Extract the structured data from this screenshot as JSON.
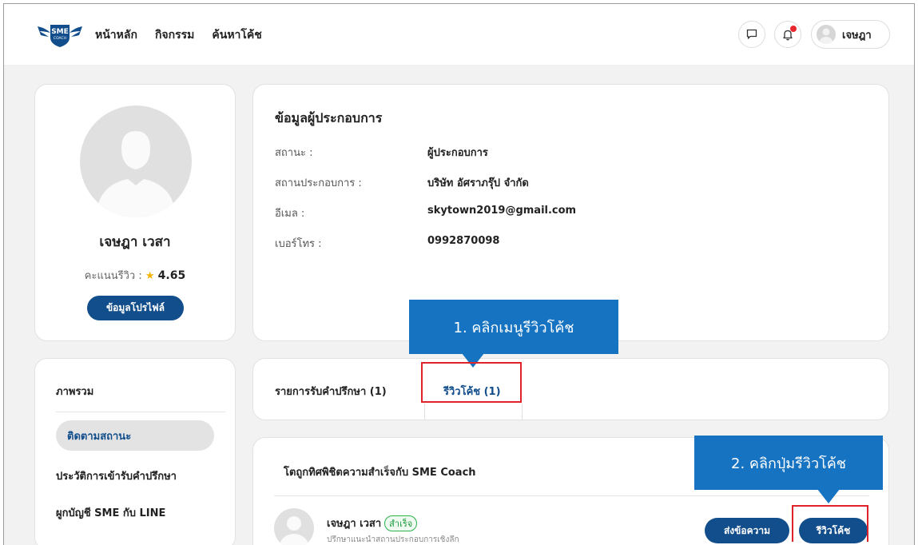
{
  "brand": {
    "logo_text": "SME",
    "logo_sub": "COACH"
  },
  "nav": {
    "items": [
      "หน้าหลัก",
      "กิจกรรม",
      "ค้นหาโค้ช"
    ]
  },
  "header": {
    "chat_icon": "chat-bubble-icon",
    "notification_icon": "bell-icon",
    "user_name": "เจษฎา"
  },
  "profile": {
    "name": "เจษฎา เวสา",
    "rating_label": "คะแนนรีวิว :",
    "rating_value": "4.65",
    "button_label": "ข้อมูลโปรไฟล์"
  },
  "info": {
    "title": "ข้อมูลผู้ประกอบการ",
    "rows": [
      {
        "label": "สถานะ :",
        "value": "ผู้ประกอบการ"
      },
      {
        "label": "สถานประกอบการ :",
        "value": "บริษัท อัศราภรุ๊ป จำกัด"
      },
      {
        "label": "อีเมล :",
        "value": "skytown2019@gmail.com"
      },
      {
        "label": "เบอร์โทร :",
        "value": "0992870098"
      }
    ]
  },
  "sidebar": {
    "heading": "ภาพรวม",
    "items": [
      "ติดตามสถานะ",
      "ประวัติการเข้ารับคำปรึกษา",
      "ผูกบัญชี SME กับ LINE"
    ]
  },
  "tabs": {
    "consult": "รายการรับคำปรึกษา (1)",
    "review": "รีวิวโค้ช (1)"
  },
  "coach": {
    "section_title": "โตถูกทิศพิชิตความสำเร็จกับ SME Coach",
    "name": "เจษฎา เวสา",
    "status": "สำเร็จ",
    "description": "ปรึกษาแนะนำสถานประกอบการเชิงลึก",
    "send_label": "ส่งข้อความ",
    "review_label": "รีวิวโค้ช"
  },
  "annotations": {
    "step1": "1. คลิกเมนูรีวิวโค้ช",
    "step2": "2. คลิกปุ่มรีวิวโค้ช"
  },
  "colors": {
    "primary": "#124e8c",
    "callout": "#1573c2",
    "highlight": "#e0222a",
    "success": "#2bb24c"
  }
}
